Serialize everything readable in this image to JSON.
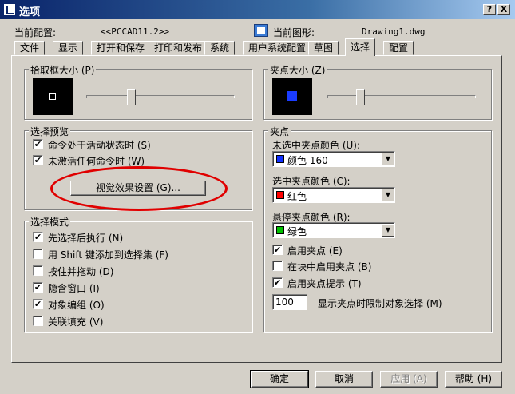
{
  "window": {
    "title": "选项",
    "help_btn": "?",
    "close_btn": "X"
  },
  "header": {
    "profile_label": "当前配置:",
    "profile_value": "<<PCCAD11.2>>",
    "drawing_label": "当前图形:",
    "drawing_value": "Drawing1.dwg"
  },
  "tabs": [
    "文件",
    "显示",
    "打开和保存",
    "打印和发布",
    "系统",
    "用户系统配置",
    "草图",
    "选择",
    "配置"
  ],
  "active_tab": "选择",
  "pickbox": {
    "title": "拾取框大小 (P)",
    "level": 0.3
  },
  "selection_preview": {
    "title": "选择预览",
    "items": [
      {
        "label": "命令处于活动状态时 (S)",
        "checked": true
      },
      {
        "label": "未激活任何命令时 (W)",
        "checked": true
      }
    ],
    "visual_button": "视觉效果设置 (G)...",
    "annotation_color": "#e00000"
  },
  "selection_mode": {
    "title": "选择模式",
    "items": [
      {
        "label": "先选择后执行 (N)",
        "checked": true
      },
      {
        "label": "用 Shift 键添加到选择集 (F)",
        "checked": false
      },
      {
        "label": "按住并拖动 (D)",
        "checked": false
      },
      {
        "label": "隐含窗口 (I)",
        "checked": true
      },
      {
        "label": "对象编组 (O)",
        "checked": true
      },
      {
        "label": "关联填充 (V)",
        "checked": false
      }
    ]
  },
  "grip_size": {
    "title": "夹点大小 (Z)",
    "level": 0.22,
    "grip_color": "#1a3cff"
  },
  "grips": {
    "title": "夹点",
    "unselected_label": "未选中夹点颜色 (U):",
    "unselected_value": "颜色 160",
    "unselected_color": "#1030ff",
    "selected_label": "选中夹点颜色 (C):",
    "selected_value": "红色",
    "selected_color": "#ff0000",
    "hover_label": "悬停夹点颜色 (R):",
    "hover_value": "绿色",
    "hover_color": "#00c000",
    "checks": [
      {
        "label": "启用夹点 (E)",
        "checked": true
      },
      {
        "label": "在块中启用夹点 (B)",
        "checked": false
      },
      {
        "label": "启用夹点提示 (T)",
        "checked": true
      }
    ],
    "limit_value": "100",
    "limit_label": "显示夹点时限制对象选择 (M)"
  },
  "buttons": {
    "ok": "确定",
    "cancel": "取消",
    "apply": "应用 (A)",
    "help": "帮助 (H)"
  },
  "check_mark": "✔"
}
